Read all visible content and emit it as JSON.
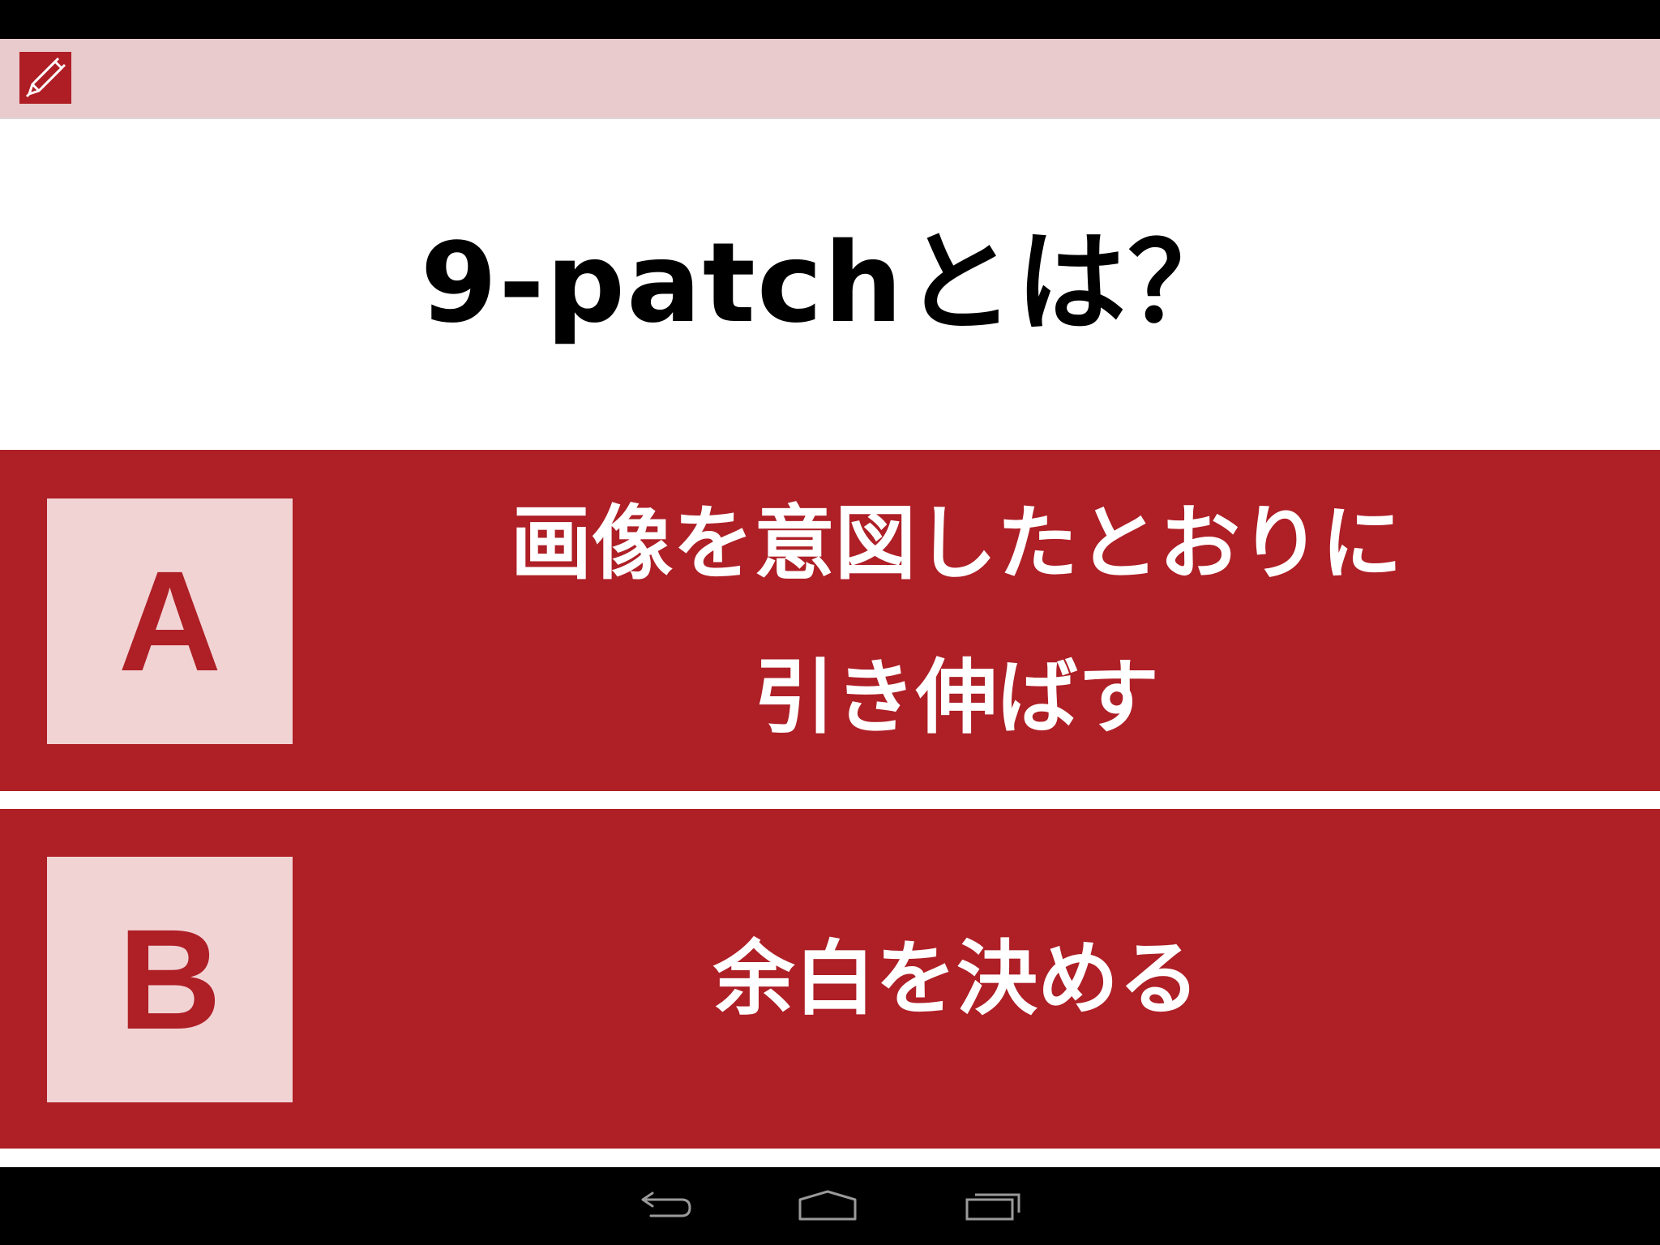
{
  "app": {
    "icon": "pencil-icon",
    "accent_color": "#ae1f26",
    "action_bar_color": "#e9cacd"
  },
  "question": {
    "text": "9-patchとは？"
  },
  "answers": [
    {
      "letter": "A",
      "text": "画像を意図したとおりに\n引き伸ばす"
    },
    {
      "letter": "B",
      "text": "余白を決める"
    }
  ],
  "nav": {
    "back_icon": "back-icon",
    "home_icon": "home-icon",
    "recents_icon": "recent-apps-icon"
  }
}
